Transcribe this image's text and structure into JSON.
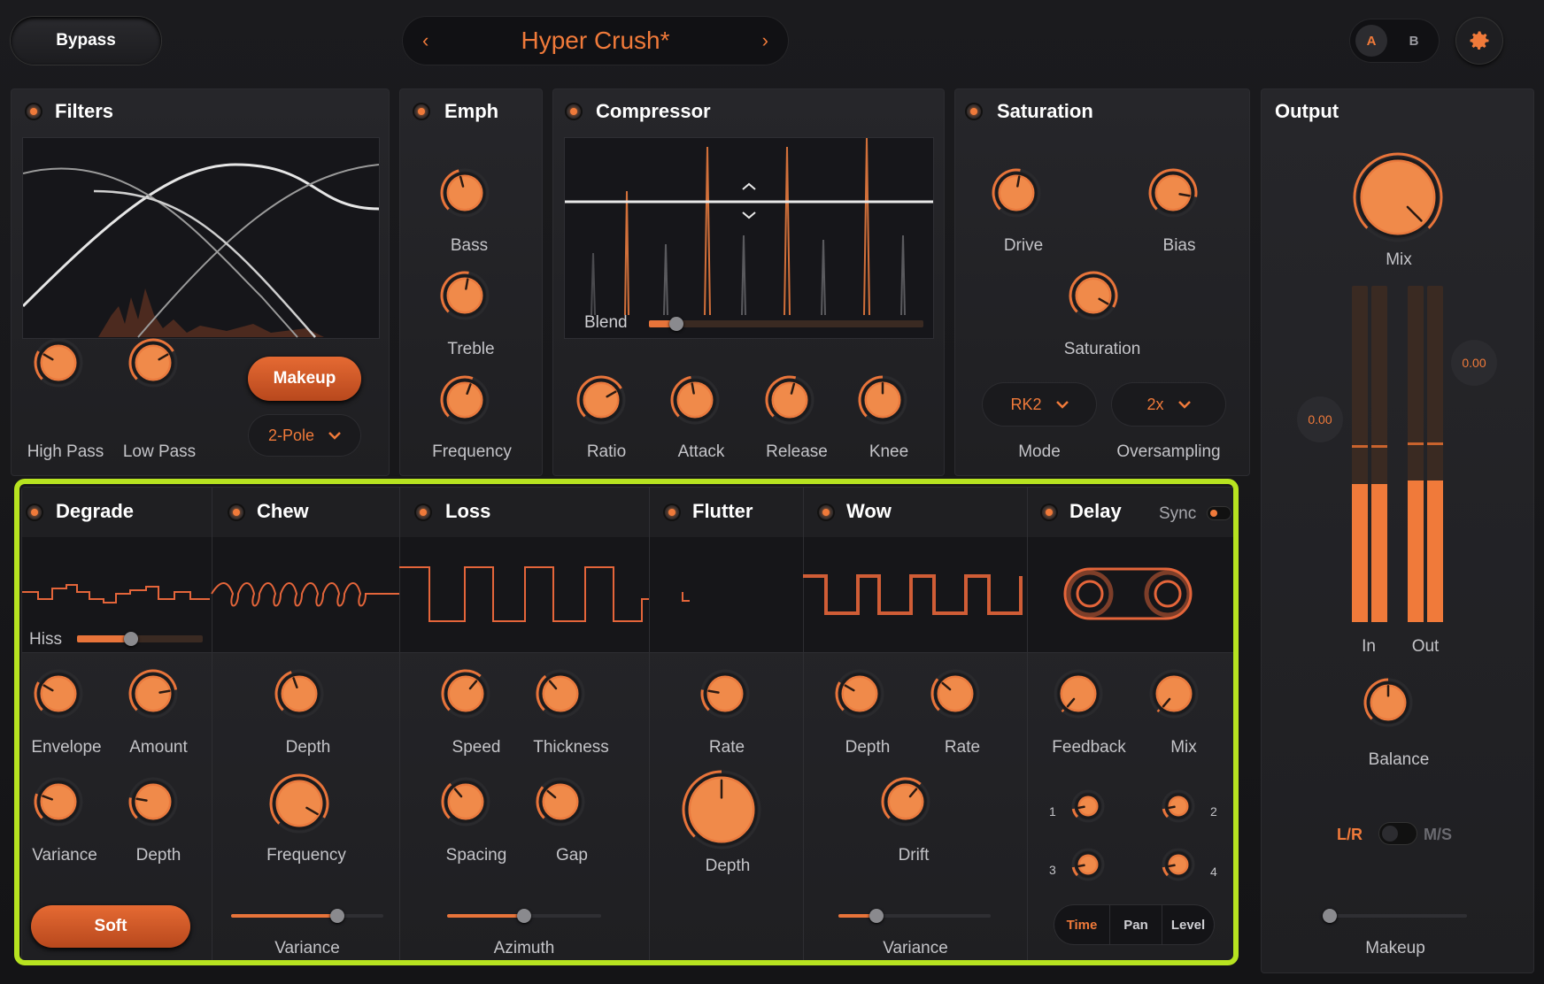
{
  "header": {
    "bypass_label": "Bypass",
    "preset_name": "Hyper Crush*",
    "prev_glyph": "‹",
    "next_glyph": "›",
    "a_label": "A",
    "b_label": "B"
  },
  "colors": {
    "accent": "#f07a3a",
    "highlight": "#b7e320"
  },
  "filters": {
    "title": "Filters",
    "makeup_label": "Makeup",
    "pole_value": "2-Pole",
    "high_pass": "High Pass",
    "low_pass": "Low Pass"
  },
  "emph": {
    "title": "Emph",
    "bass": "Bass",
    "treble": "Treble",
    "frequency": "Frequency"
  },
  "compressor": {
    "title": "Compressor",
    "blend_label": "Blend",
    "ratio": "Ratio",
    "attack": "Attack",
    "release": "Release",
    "knee": "Knee"
  },
  "saturation": {
    "title": "Saturation",
    "drive": "Drive",
    "bias": "Bias",
    "saturation": "Saturation",
    "mode_value": "RK2",
    "mode_label": "Mode",
    "oversampling_value": "2x",
    "oversampling_label": "Oversampling"
  },
  "output": {
    "title": "Output",
    "mix": "Mix",
    "in_label": "In",
    "out_label": "Out",
    "in_value": "0.00",
    "out_value": "0.00",
    "balance": "Balance",
    "lr": "L/R",
    "ms": "M/S",
    "makeup": "Makeup"
  },
  "degrade": {
    "title": "Degrade",
    "hiss": "Hiss",
    "envelope": "Envelope",
    "amount": "Amount",
    "variance": "Variance",
    "depth": "Depth",
    "soft": "Soft"
  },
  "chew": {
    "title": "Chew",
    "depth": "Depth",
    "frequency": "Frequency",
    "variance": "Variance"
  },
  "loss": {
    "title": "Loss",
    "speed": "Speed",
    "thickness": "Thickness",
    "spacing": "Spacing",
    "gap": "Gap",
    "azimuth": "Azimuth"
  },
  "flutter": {
    "title": "Flutter",
    "rate": "Rate",
    "depth": "Depth"
  },
  "wow": {
    "title": "Wow",
    "depth": "Depth",
    "rate": "Rate",
    "drift": "Drift",
    "variance": "Variance"
  },
  "delay": {
    "title": "Delay",
    "sync": "Sync",
    "feedback": "Feedback",
    "mix": "Mix",
    "tap1": "1",
    "tap2": "2",
    "tap3": "3",
    "tap4": "4",
    "time": "Time",
    "pan": "Pan",
    "level": "Level"
  },
  "icons": {
    "gear": "gear-icon",
    "chevron": "chevron-down-icon",
    "reel": "tape-reel-icon"
  }
}
